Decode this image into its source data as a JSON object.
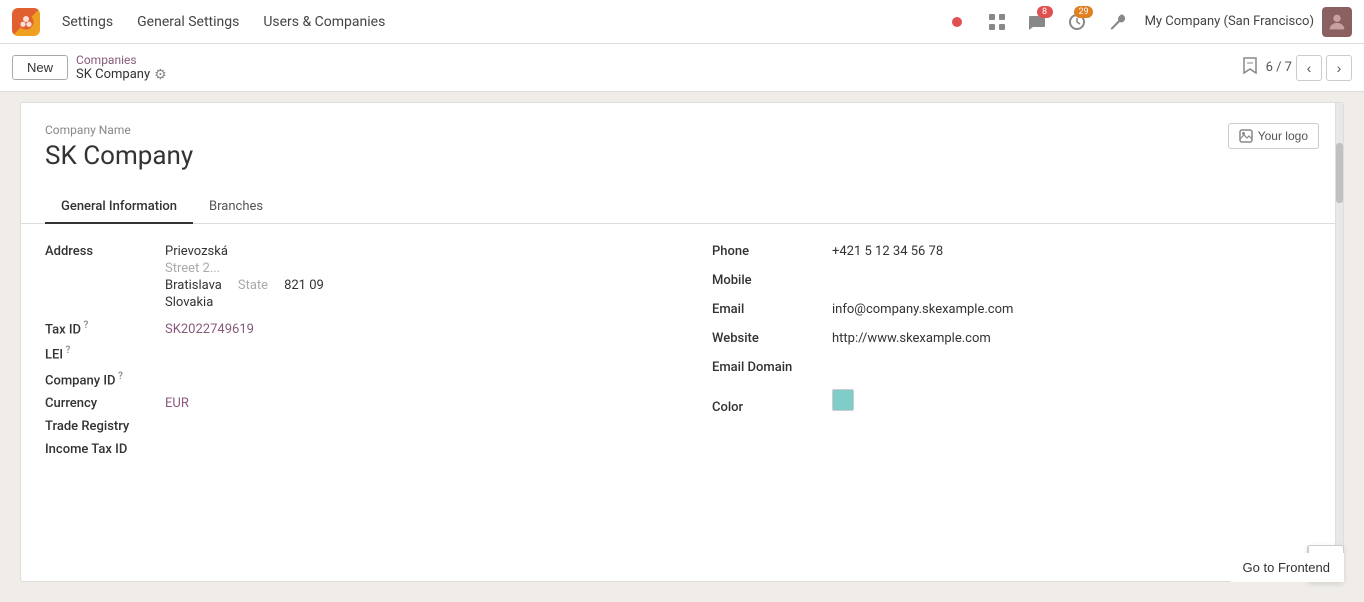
{
  "topnav": {
    "logo_alt": "Odoo logo",
    "items": [
      {
        "label": "Settings"
      },
      {
        "label": "General Settings"
      },
      {
        "label": "Users & Companies"
      }
    ],
    "icons": {
      "dot_red": "●",
      "grid": "⊞",
      "chat_badge": "8",
      "activity_badge": "29",
      "wrench": "🔧"
    },
    "company": "My Company (San Francisco)",
    "avatar_alt": "User avatar"
  },
  "actionbar": {
    "new_label": "New",
    "breadcrumb_parent": "Companies",
    "breadcrumb_current": "SK Company",
    "pager": "6 / 7"
  },
  "form": {
    "company_name_label": "Company Name",
    "company_title": "SK Company",
    "logo_btn": "Your logo",
    "tabs": [
      {
        "label": "General Information",
        "active": true
      },
      {
        "label": "Branches"
      }
    ],
    "address": {
      "label": "Address",
      "line1": "Prievozská",
      "line2_placeholder": "Street 2...",
      "city": "Bratislava",
      "state_placeholder": "State",
      "zip": "821 09",
      "country": "Slovakia"
    },
    "tax_id": {
      "label": "Tax ID",
      "tooltip": "?",
      "value": "SK2022749619"
    },
    "lei": {
      "label": "LEI",
      "tooltip": "?"
    },
    "company_id": {
      "label": "Company ID",
      "tooltip": "?"
    },
    "currency": {
      "label": "Currency",
      "value": "EUR"
    },
    "trade_registry": {
      "label": "Trade Registry"
    },
    "income_tax_id": {
      "label": "Income Tax ID"
    },
    "phone": {
      "label": "Phone",
      "value": "+421 5 12 34 56 78"
    },
    "mobile": {
      "label": "Mobile"
    },
    "email": {
      "label": "Email",
      "value": "info@company.skexample.com"
    },
    "website": {
      "label": "Website",
      "value": "http://www.skexample.com"
    },
    "email_domain": {
      "label": "Email Domain"
    },
    "color": {
      "label": "Color",
      "swatch_color": "#7ecdc8"
    }
  },
  "bottom": {
    "btn_label": "Go to Frontend"
  }
}
